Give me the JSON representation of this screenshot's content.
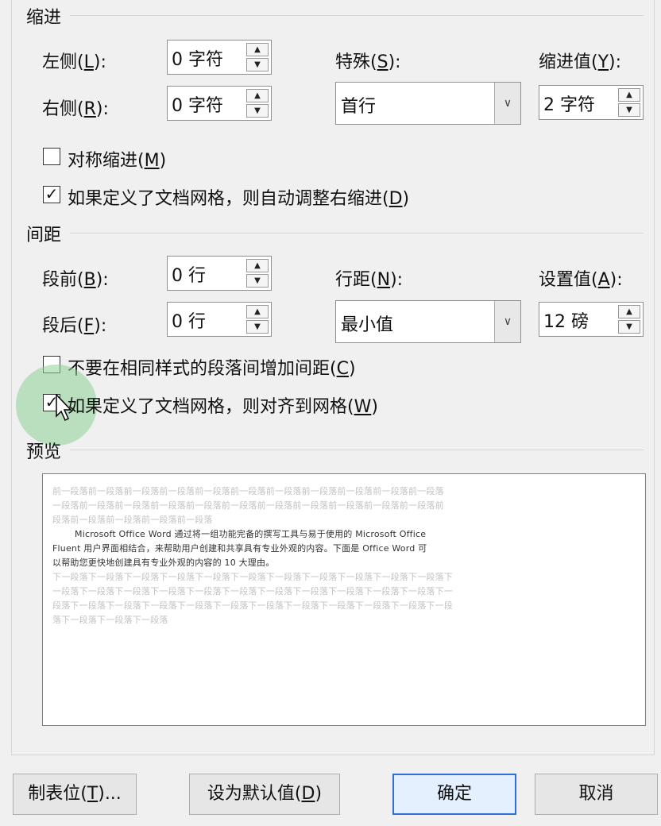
{
  "indent": {
    "title": "缩进",
    "left": {
      "prefix": "左侧(",
      "key": "L",
      "suffix": "):",
      "value": "0 字符"
    },
    "right": {
      "prefix": "右侧(",
      "key": "R",
      "suffix": "):",
      "value": "0 字符"
    },
    "special": {
      "prefix": "特殊(",
      "key": "S",
      "suffix": "):",
      "value": "首行"
    },
    "indent_value": {
      "prefix": "缩进值(",
      "key": "Y",
      "suffix": "):",
      "value": "2 字符"
    },
    "mirror": {
      "prefix": "对称缩进(",
      "key": "M",
      "suffix": ")",
      "checked": false
    },
    "auto_adjust": {
      "prefix": "如果定义了文档网格，则自动调整右缩进(",
      "key": "D",
      "suffix": ")",
      "checked": true
    }
  },
  "spacing": {
    "title": "间距",
    "before": {
      "prefix": "段前(",
      "key": "B",
      "suffix": "):",
      "value": "0 行"
    },
    "after": {
      "prefix": "段后(",
      "key": "F",
      "suffix": "):",
      "value": "0 行"
    },
    "line_spacing": {
      "prefix": "行距(",
      "key": "N",
      "suffix": "):",
      "value": "最小值"
    },
    "at": {
      "prefix": "设置值(",
      "key": "A",
      "suffix": "):",
      "value": "12 磅"
    },
    "dont_add": {
      "prefix": "不要在相同样式的段落间增加间距(",
      "key": "C",
      "suffix": ")",
      "checked": false
    },
    "snap_grid": {
      "prefix": "如果定义了文档网格，则对齐到网格(",
      "key": "W",
      "suffix": ")",
      "checked": true
    }
  },
  "preview": {
    "title": "预览",
    "prev_lines": [
      "前一段落前一段落前一段落前一段落前一段落前一段落前一段落前一段落前一段落前一段落前一段落",
      "一段落前一段落前一段落前一段落前一段落前一段落前一段落前一段落前一段落前一段落前一段落前",
      "段落前一段落前一段落前一段落前一段落"
    ],
    "main_lines": [
      "Microsoft Office Word 通过将一组功能完备的撰写工具与易于使用的 Microsoft Office",
      "Fluent 用户界面相结合，来帮助用户创建和共享具有专业外观的内容。下面是 Office Word 可",
      "以帮助您更快地创建具有专业外观的内容的 10 大理由。"
    ],
    "next_lines": [
      "下一段落下一段落下一段落下一段落下一段落下一段落下一段落下一段落下一段落下一段落下一段落下",
      "一段落下一段落下一段落下一段落下一段落下一段落下一段落下一段落下一段落下一段落下一段落下一",
      "段落下一段落下一段落下一段落下一段落下一段落下一段落下一段落下一段落下一段落下一段落下一段",
      "落下一段落下一段落下一段落"
    ]
  },
  "buttons": {
    "tabs": {
      "prefix": "制表位(",
      "key": "T",
      "suffix": ")..."
    },
    "set_default": {
      "prefix": "设为默认值(",
      "key": "D",
      "suffix": ")"
    },
    "ok": "确定",
    "cancel": "取消"
  }
}
